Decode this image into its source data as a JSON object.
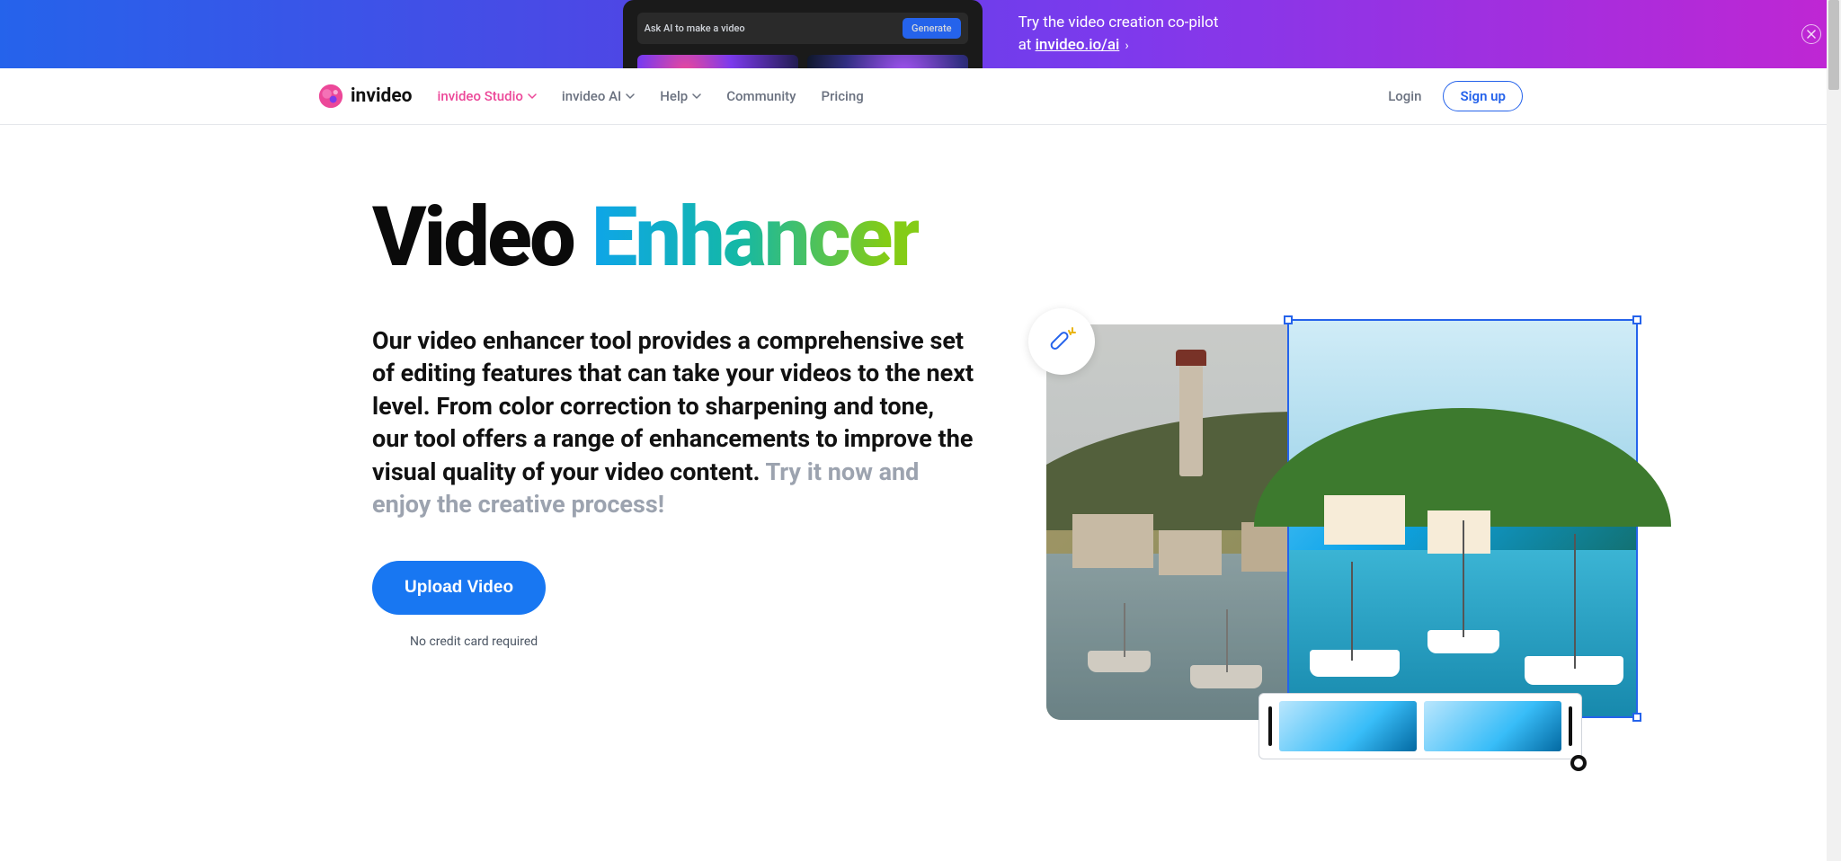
{
  "promo": {
    "mock_label": "Ask AI to make a video",
    "mock_btn": "Generate",
    "line1": "Try the video creation co-pilot",
    "line2_prefix": "at ",
    "link_text": "invideo.io/ai",
    "arrow": "›"
  },
  "brand": {
    "name": "invideo"
  },
  "nav": {
    "studio": "invideo Studio",
    "ai": "invideo AI",
    "help": "Help",
    "community": "Community",
    "pricing": "Pricing",
    "login": "Login",
    "signup": "Sign up"
  },
  "hero": {
    "title_plain": "Video ",
    "title_grad": "Enhancer",
    "desc_main": "Our video enhancer tool provides a comprehensive set of editing features that can take your videos to the next level. From color correction to sharpening and tone, our tool offers a range of enhancements to improve the visual quality of your video content. ",
    "desc_muted": "Try it now and enjoy the creative process!",
    "upload_btn": "Upload Video",
    "nocard": "No credit card required"
  }
}
